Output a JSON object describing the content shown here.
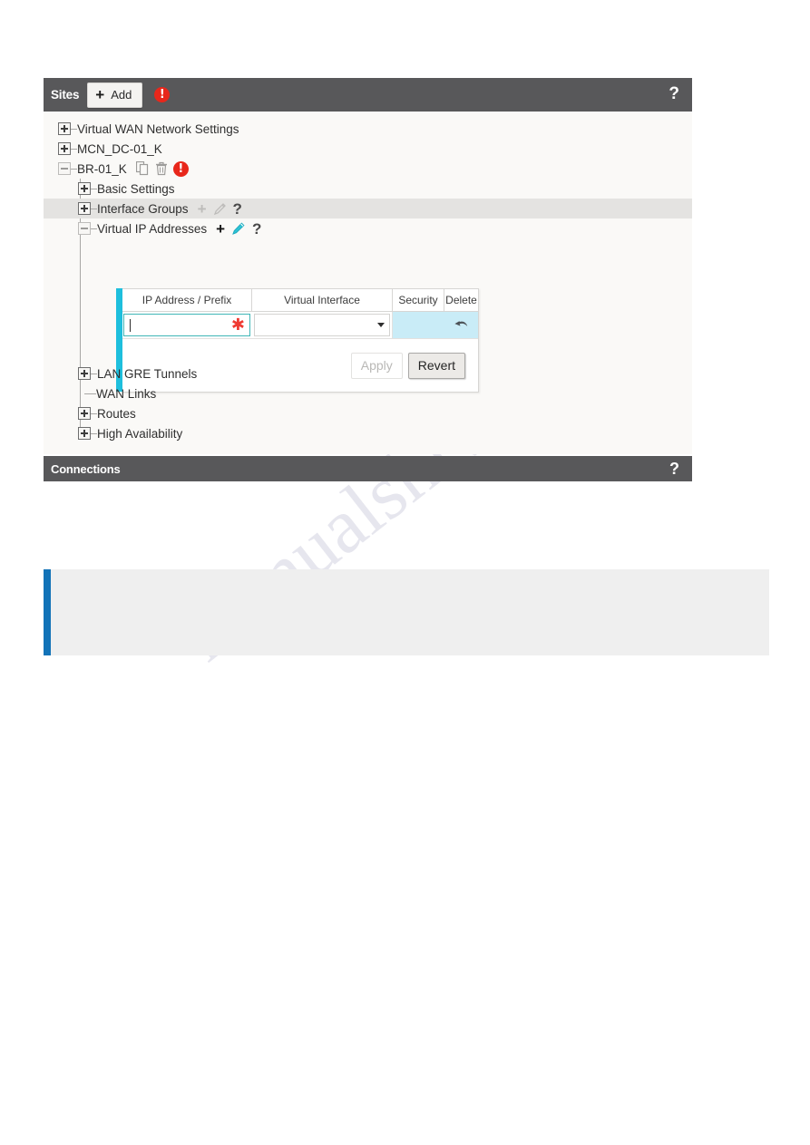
{
  "panel": {
    "title": "Sites",
    "add_label": "Add",
    "add_icon": "plus-icon",
    "error_icon": "error-exclamation-icon",
    "help_label": "?"
  },
  "tree": {
    "items": [
      {
        "label": "Virtual WAN Network Settings",
        "state": "collapsed",
        "indent": 0,
        "icons": []
      },
      {
        "label": "MCN_DC-01_K",
        "state": "collapsed",
        "indent": 0,
        "icons": []
      },
      {
        "label": "BR-01_K",
        "state": "expanded",
        "indent": 0,
        "icons": [
          "copy-icon",
          "trash-icon",
          "error-exclamation-icon"
        ]
      },
      {
        "label": "Basic Settings",
        "state": "collapsed",
        "indent": 1,
        "icons": []
      },
      {
        "label": "Interface Groups",
        "state": "collapsed",
        "indent": 1,
        "icons": [
          "plus-icon",
          "pencil-icon",
          "help-icon"
        ],
        "highlighted": true
      },
      {
        "label": "Virtual IP Addresses",
        "state": "expanded",
        "indent": 1,
        "icons": [
          "plus-icon",
          "pencil-icon",
          "help-icon"
        ]
      },
      {
        "label": "LAN GRE Tunnels",
        "state": "collapsed",
        "indent": 1,
        "icons": []
      },
      {
        "label": "WAN Links",
        "state": "leaf",
        "indent": 1,
        "icons": []
      },
      {
        "label": "Routes",
        "state": "collapsed",
        "indent": 1,
        "icons": []
      },
      {
        "label": "High Availability",
        "state": "collapsed",
        "indent": 1,
        "icons": []
      }
    ]
  },
  "vip_table": {
    "columns": [
      "IP Address / Prefix",
      "Virtual Interface",
      "Security",
      "Delete"
    ],
    "row": {
      "ip_value": "",
      "ip_required_marker": "✱",
      "virtual_interface_value": "",
      "security_value": "",
      "delete_icon": "undo-arrow-icon"
    },
    "apply_label": "Apply",
    "revert_label": "Revert",
    "apply_enabled": false
  },
  "connections": {
    "title": "Connections",
    "help_label": "?"
  },
  "watermark": {
    "line1": "e.com",
    "line2": "manualshive"
  },
  "colors": {
    "header_bar": "#58585a",
    "panel_body": "#faf9f7",
    "row_highlight": "#e4e3e1",
    "accent_teal": "#1ebfdd",
    "accent_blue": "#1273b8",
    "error_red": "#e8271b",
    "required_red": "#ef3b33",
    "security_cell": "#c9ecf7",
    "note_bg": "#efefef"
  }
}
